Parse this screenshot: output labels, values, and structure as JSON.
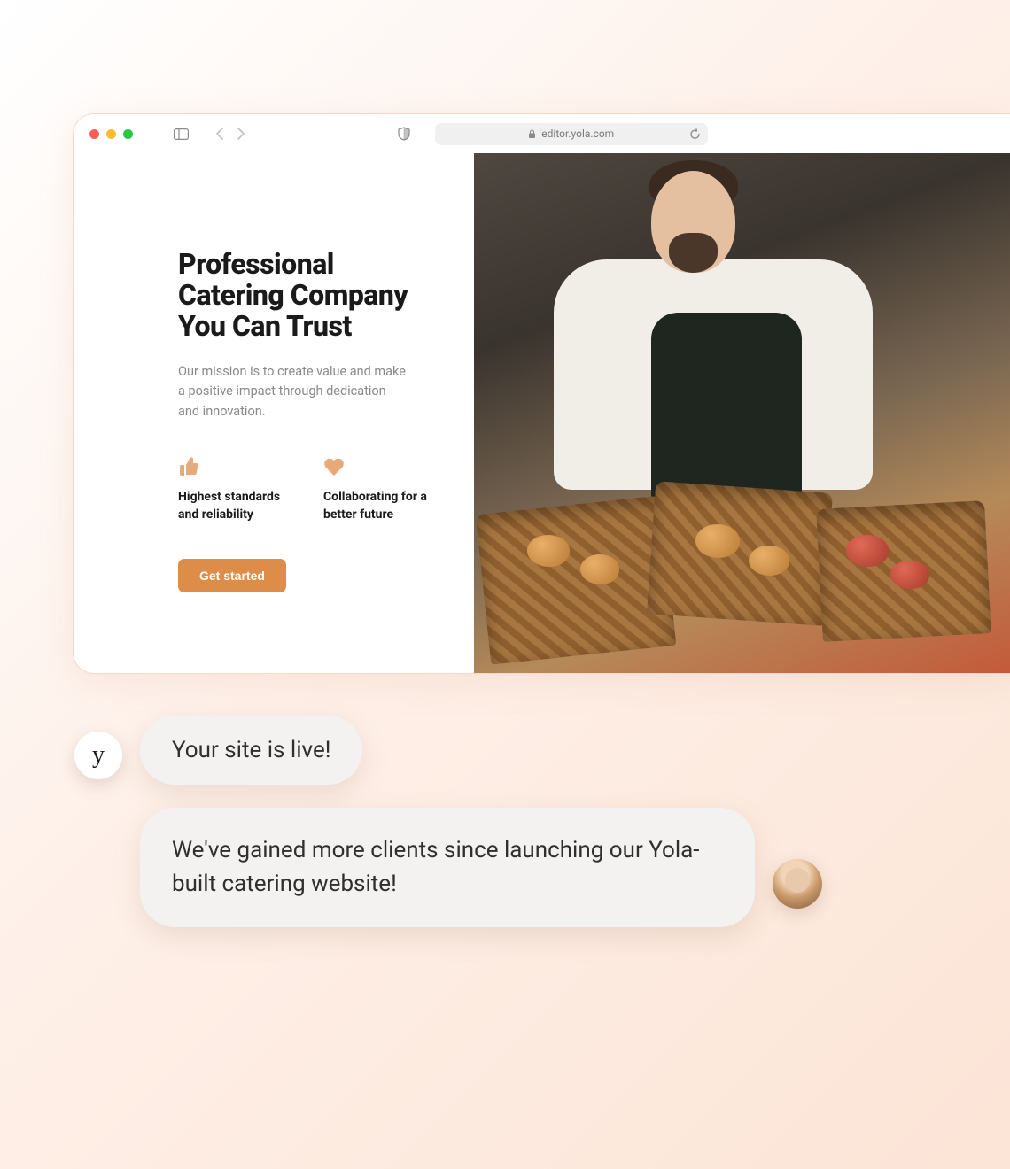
{
  "browser": {
    "url_host": "editor.yola.com"
  },
  "hero": {
    "title": "Professional Catering Company You Can Trust",
    "subtitle": "Our mission is to create value and make a positive impact through dedication and innovation.",
    "cta_label": "Get started"
  },
  "features": [
    {
      "icon": "thumbs-up-icon",
      "text": "Highest standards and reliability"
    },
    {
      "icon": "heart-icon",
      "text": "Collaborating for a better future"
    }
  ],
  "chat": {
    "brand_initial": "y",
    "message_brand": "Your site is live!",
    "message_user": "We've gained more clients since launching our Yola-built catering website!"
  },
  "colors": {
    "accent": "#dd8d48",
    "icon_tint": "#e9aa7a"
  }
}
